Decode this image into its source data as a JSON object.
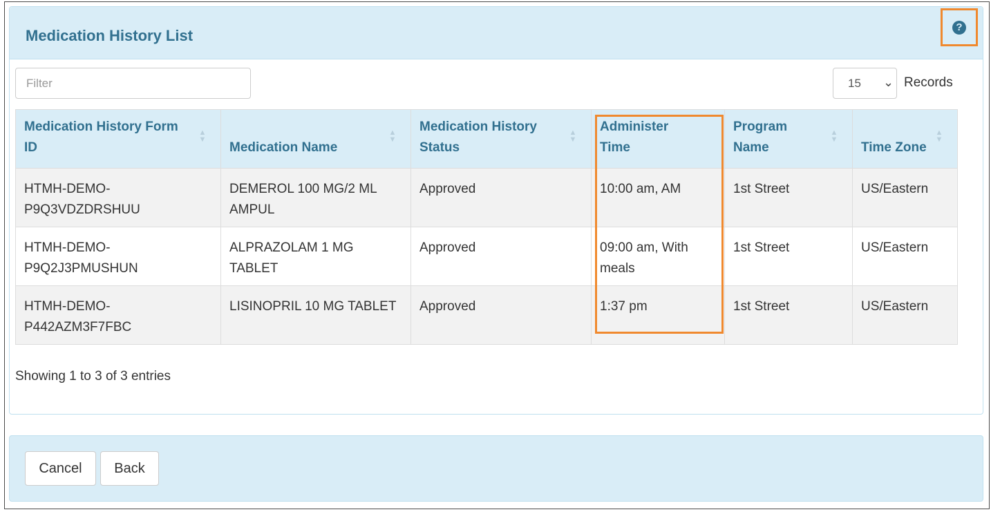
{
  "panel": {
    "title": "Medication History List",
    "help_icon": "question-circle-icon"
  },
  "filter": {
    "placeholder": "Filter",
    "value": ""
  },
  "records": {
    "selected": "15",
    "label": "Records"
  },
  "table": {
    "columns": [
      "Medication History Form ID",
      "Medication Name",
      "Medication History Status",
      "Administer Time",
      "Program Name",
      "Time Zone"
    ],
    "rows": [
      [
        "HTMH-DEMO-P9Q3VDZDRSHUU",
        "DEMEROL 100 MG/2 ML AMPUL",
        "Approved",
        "10:00 am, AM",
        "1st Street",
        "US/Eastern"
      ],
      [
        "HTMH-DEMO-P9Q2J3PMUSHUN",
        "ALPRAZOLAM 1 MG TABLET",
        "Approved",
        "09:00 am, With meals",
        "1st Street",
        "US/Eastern"
      ],
      [
        "HTMH-DEMO-P442AZM3F7FBC",
        "LISINOPRIL 10 MG TABLET",
        "Approved",
        "1:37 pm",
        "1st Street",
        "US/Eastern"
      ]
    ]
  },
  "info": {
    "entries": "Showing 1 to 3 of 3 entries"
  },
  "footer": {
    "cancel_label": "Cancel",
    "back_label": "Back"
  },
  "colors": {
    "header_bg": "#d9edf7",
    "header_text": "#31708f",
    "highlight": "#f0892e"
  }
}
